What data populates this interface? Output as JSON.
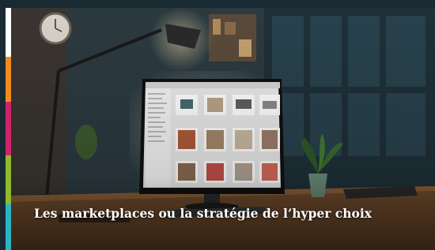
{
  "article_card": {
    "title": "Les marketplaces ou la stratégie de l’hyper choix",
    "image_alt": "Illuminated computer monitor displaying an online marketplace on a desk in a dim living room"
  },
  "colors": {
    "stripe": [
      "#ffffff",
      "#f08c1e",
      "#d0246a",
      "#8dbb2b",
      "#2bb6c4"
    ],
    "title_text": "#ffffff"
  }
}
